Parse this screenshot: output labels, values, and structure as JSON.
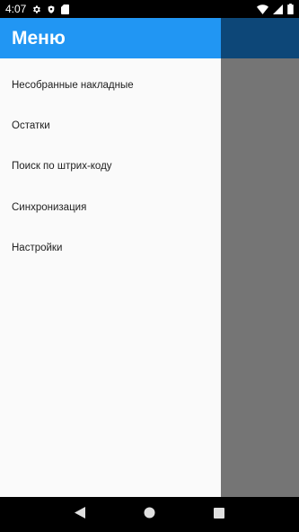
{
  "status_bar": {
    "time": "4:07",
    "icons": [
      "gear-icon",
      "shield-icon",
      "sd-card-icon",
      "wifi-icon",
      "signal-icon",
      "battery-icon"
    ]
  },
  "drawer": {
    "title": "Меню",
    "items": [
      {
        "label": "Несобранные накладные"
      },
      {
        "label": "Остатки"
      },
      {
        "label": "Поиск по штрих-коду"
      },
      {
        "label": "Синхронизация"
      },
      {
        "label": "Настройки"
      }
    ]
  },
  "nav_bar": {
    "buttons": [
      "back-icon",
      "home-icon",
      "recents-icon"
    ]
  },
  "colors": {
    "accent": "#2196f3",
    "scrim": "#757575",
    "dimmed_toolbar": "#0d4778"
  }
}
